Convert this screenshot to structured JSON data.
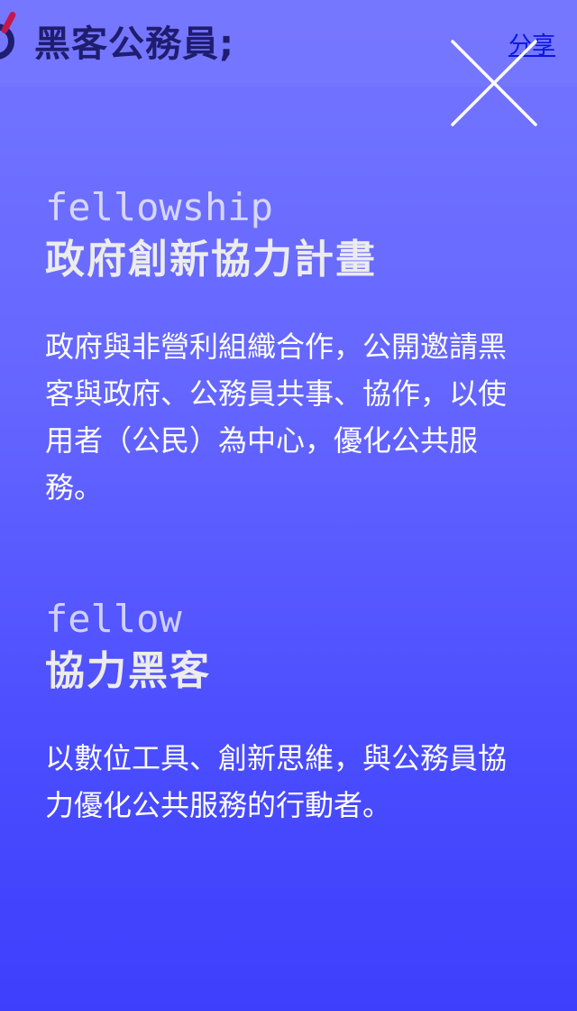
{
  "header": {
    "site_title": "黑客公務員;",
    "share_label": "分享",
    "close_icon": "close-icon"
  },
  "sections": [
    {
      "en_label": "fellowship",
      "title": "政府創新協力計畫",
      "description": "政府與非營利組織合作，公開邀請黑客與政府、公務員共事、協作，以使用者（公民）為中心，優化公共服務。"
    },
    {
      "en_label": "fellow",
      "title": "協力黑客",
      "description": "以數位工具、創新思維，與公務員協力優化公共服務的行動者。"
    }
  ],
  "colors": {
    "background_top": "#7476ff",
    "background_bottom": "#3d3ffc",
    "logo_navy": "#1f1d6e",
    "logo_accent": "#c2184f",
    "share_link": "#0a16e0"
  }
}
